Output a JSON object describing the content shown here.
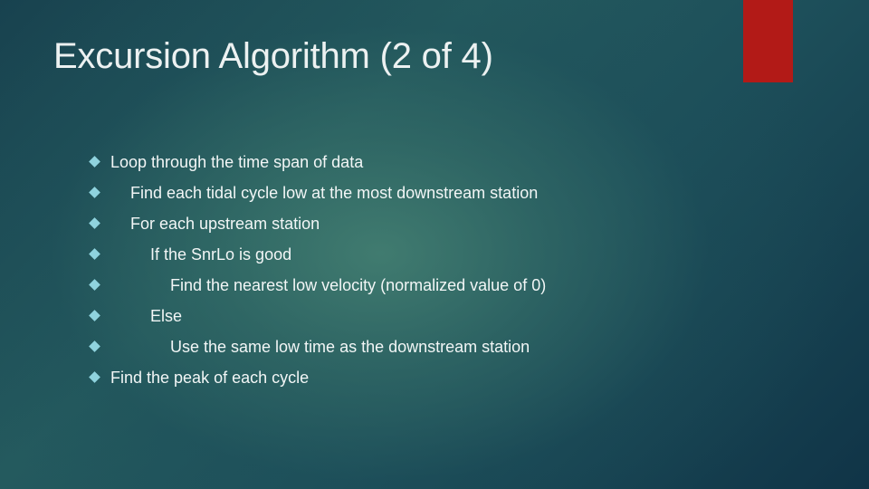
{
  "slide": {
    "title": "Excursion Algorithm (2 of 4)",
    "accent_color": "#b21a17",
    "bullet_icon": "diamond-bullet-icon",
    "bullets": [
      {
        "level": 0,
        "text": "Loop through the time span of data"
      },
      {
        "level": 1,
        "text": "Find each tidal cycle low at the most downstream station"
      },
      {
        "level": 1,
        "text": "For each upstream station"
      },
      {
        "level": 2,
        "text": "If the SnrLo is good"
      },
      {
        "level": 3,
        "text": "Find the nearest low velocity (normalized value of 0)"
      },
      {
        "level": 2,
        "text": "Else"
      },
      {
        "level": 3,
        "text": "Use the same low time as the downstream station"
      },
      {
        "level": 0,
        "text": "Find the peak of each cycle"
      }
    ]
  }
}
